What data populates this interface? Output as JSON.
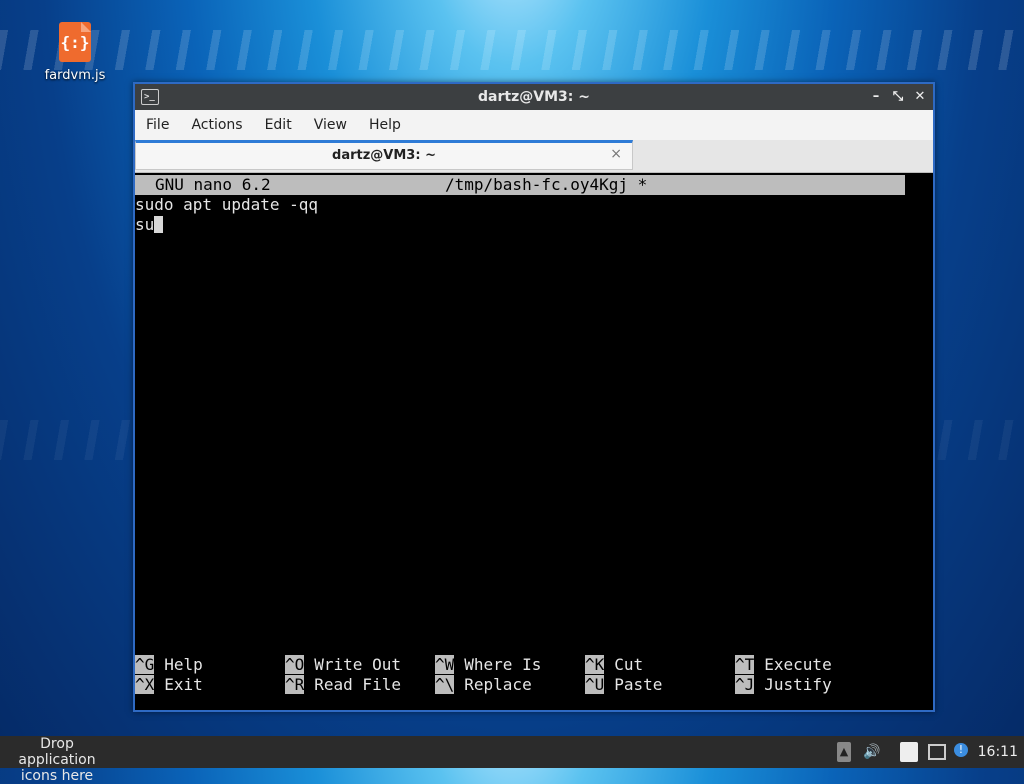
{
  "desktop": {
    "icons": [
      {
        "label": "fardvm.js",
        "glyph": "{:}",
        "icon": "javascript-file-icon"
      }
    ]
  },
  "window": {
    "title": "dartz@VM3: ~",
    "controls": {
      "minimize": "–",
      "maximize": "⤡",
      "close": "✕"
    }
  },
  "menubar": {
    "items": [
      "File",
      "Actions",
      "Edit",
      "View",
      "Help"
    ]
  },
  "tabs": [
    {
      "label": "dartz@VM3: ~",
      "close": "×"
    }
  ],
  "nano": {
    "version": "GNU nano 6.2",
    "filename": "/tmp/bash-fc.oy4Kgj *",
    "lines": [
      "sudo apt update -qq",
      "su"
    ],
    "shortcuts_row1": [
      {
        "key": "^G",
        "label": "Help"
      },
      {
        "key": "^O",
        "label": "Write Out"
      },
      {
        "key": "^W",
        "label": "Where Is"
      },
      {
        "key": "^K",
        "label": "Cut"
      },
      {
        "key": "^T",
        "label": "Execute"
      }
    ],
    "shortcuts_row2": [
      {
        "key": "^X",
        "label": "Exit"
      },
      {
        "key": "^R",
        "label": "Read File"
      },
      {
        "key": "^\\",
        "label": "Replace"
      },
      {
        "key": "^U",
        "label": "Paste"
      },
      {
        "key": "^J",
        "label": "Justify"
      }
    ]
  },
  "taskbar": {
    "drop_text_line1": "Drop application",
    "drop_text_line2": "icons here",
    "tray_icons": [
      "up-arrow-icon",
      "volume-icon",
      "clipboard-icon",
      "network-icon",
      "update-notifier-icon"
    ],
    "clock": "16:11"
  }
}
